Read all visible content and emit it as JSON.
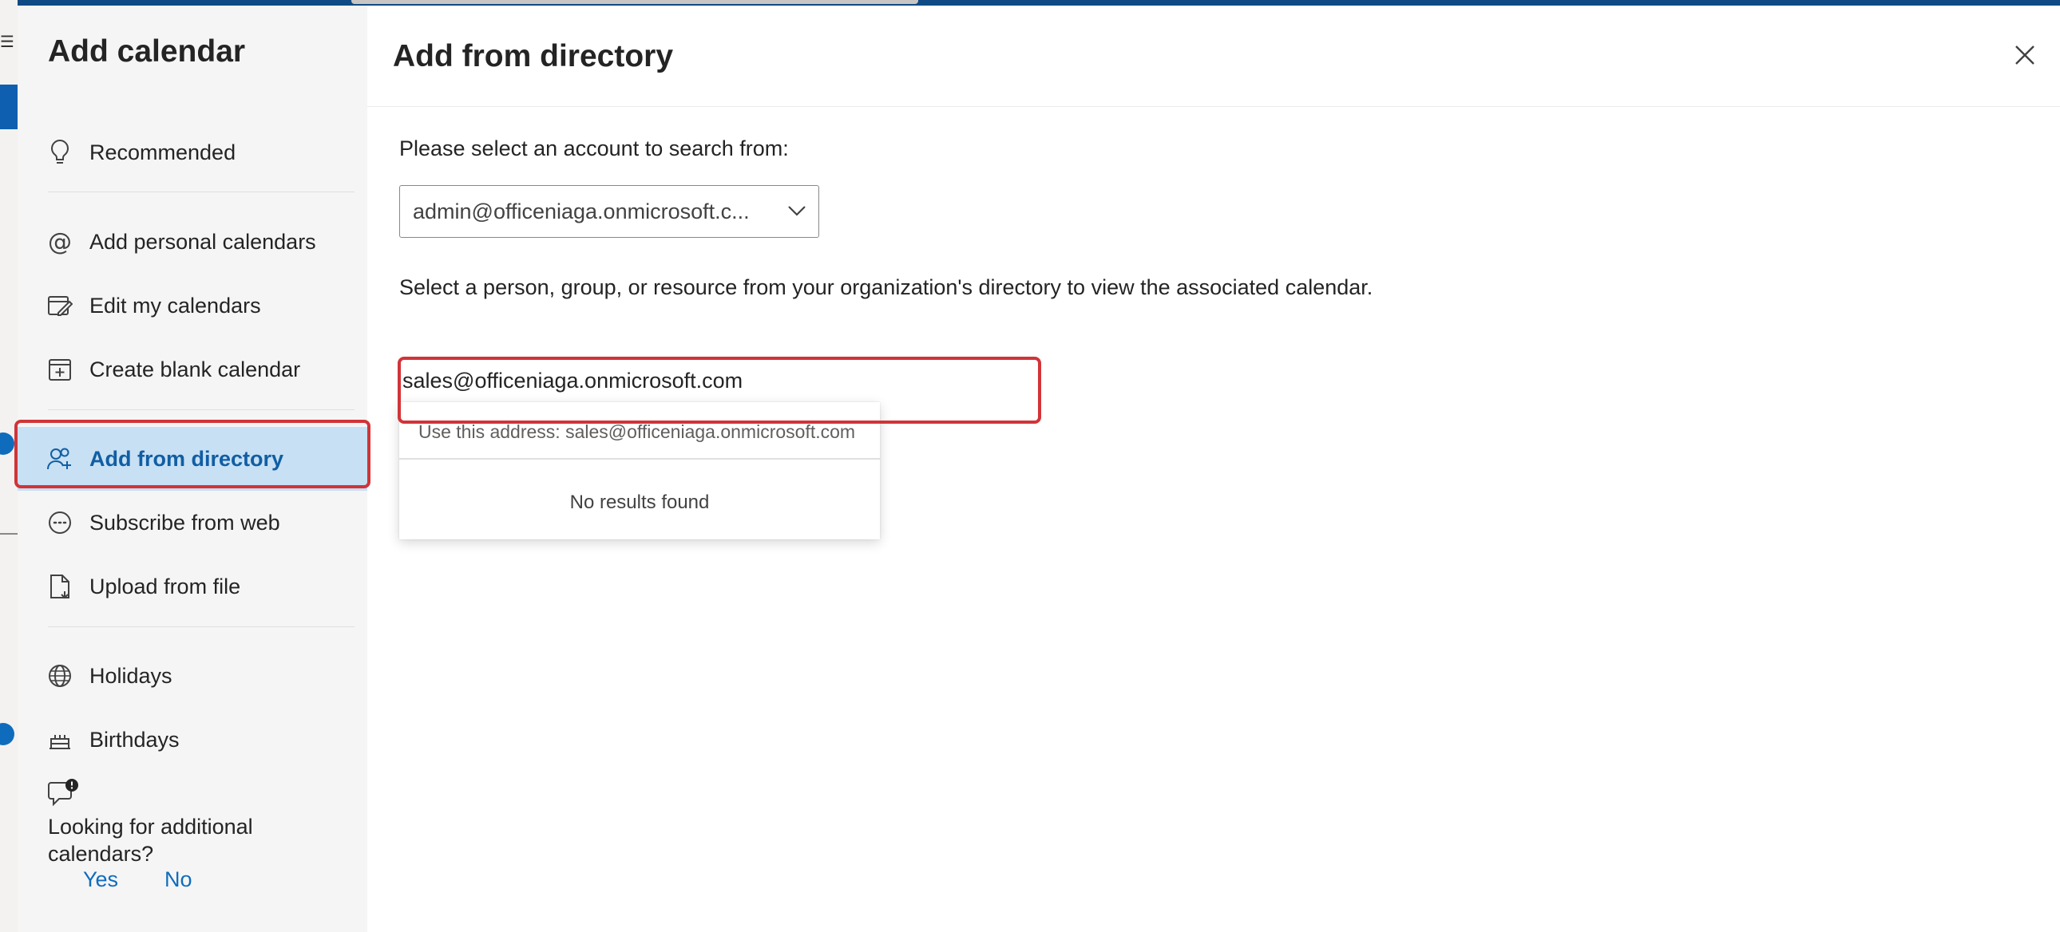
{
  "dialog": {
    "nav_title": "Add calendar",
    "nav_items": [
      {
        "label": "Recommended",
        "icon": "lightbulb-icon"
      },
      {
        "label": "Add personal calendars",
        "icon": "at-sign-icon"
      },
      {
        "label": "Edit my calendars",
        "icon": "edit-calendar-icon"
      },
      {
        "label": "Create blank calendar",
        "icon": "calendar-add-icon"
      },
      {
        "label": "Add from directory",
        "icon": "people-add-icon",
        "active": true
      },
      {
        "label": "Subscribe from web",
        "icon": "link-circle-icon"
      },
      {
        "label": "Upload from file",
        "icon": "document-arrow-icon"
      },
      {
        "label": "Holidays",
        "icon": "globe-icon"
      },
      {
        "label": "Birthdays",
        "icon": "cake-icon"
      }
    ],
    "feedback": {
      "question": "Looking for additional calendars?",
      "yes": "Yes",
      "no": "No",
      "icon": "chat-feedback-icon"
    }
  },
  "main": {
    "title": "Add from directory",
    "account_prompt": "Please select an account to search from:",
    "account_value": "admin@officeniaga.onmicrosoft.c...",
    "description": "Select a person, group, or resource from your organization's directory to view the associated calendar.",
    "search_value": "sales@officeniaga.onmicrosoft.com",
    "suggestion": "Use this address: sales@officeniaga.onmicrosoft.com",
    "no_results": "No results found"
  },
  "colors": {
    "accent": "#0f6cbd",
    "active_bg": "#c7e0f4",
    "highlight": "#d13438"
  }
}
